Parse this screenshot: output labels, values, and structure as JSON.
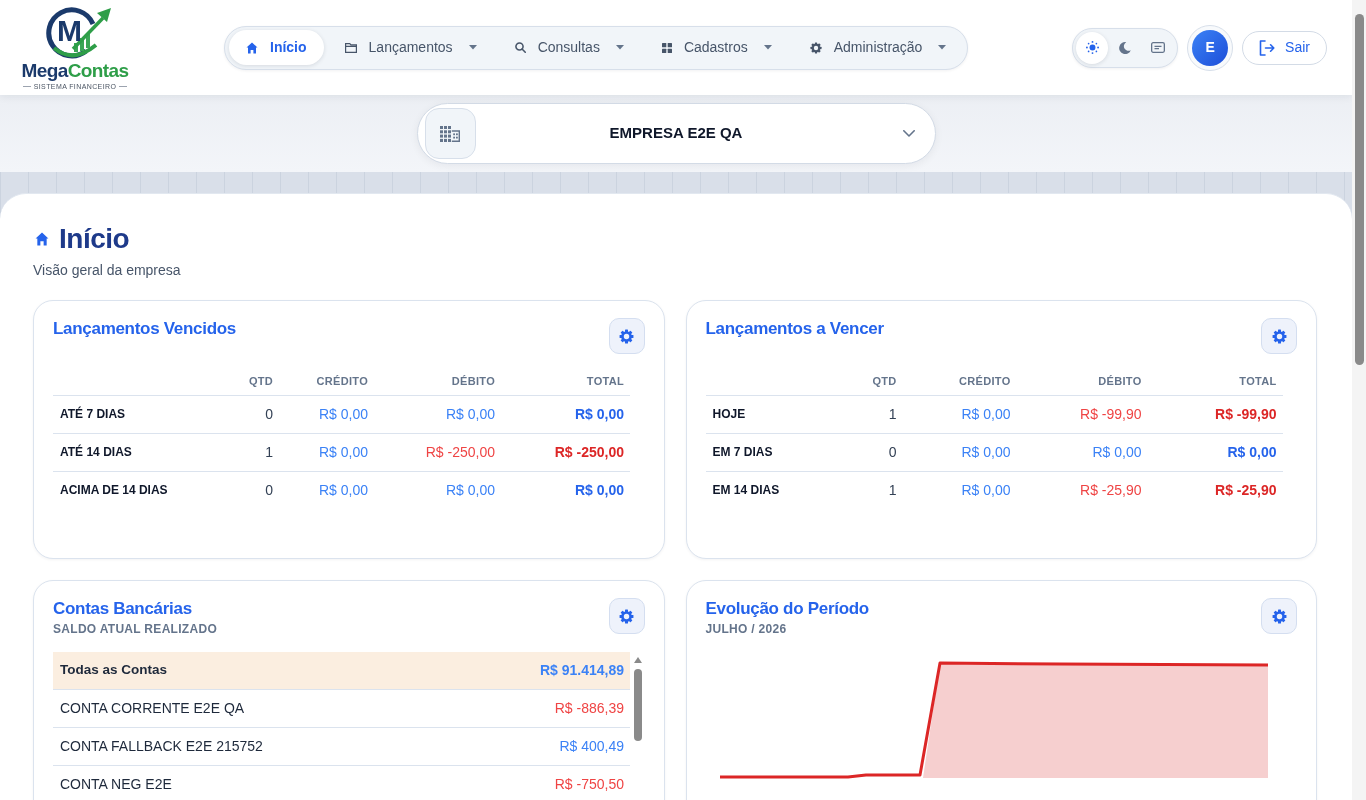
{
  "header": {
    "logo": {
      "monogram": "M",
      "brand_first": "Mega",
      "brand_second": "Contas",
      "tagline": "SISTEMA FINANCEIRO"
    },
    "nav": [
      {
        "label": "Início",
        "selected": true,
        "has_menu": false
      },
      {
        "label": "Lançamentos",
        "selected": false,
        "has_menu": true
      },
      {
        "label": "Consultas",
        "selected": false,
        "has_menu": true
      },
      {
        "label": "Cadastros",
        "selected": false,
        "has_menu": true
      },
      {
        "label": "Administração",
        "selected": false,
        "has_menu": true
      }
    ],
    "theme_options": [
      {
        "selected": true
      },
      {
        "selected": false
      },
      {
        "selected": false
      }
    ],
    "user": {
      "initial": "E"
    },
    "logout": {
      "label": "Sair"
    }
  },
  "company_selector": {
    "name": "EMPRESA E2E QA"
  },
  "page": {
    "title": "Início",
    "subtitle": "Visão geral da empresa"
  },
  "overdue": {
    "title": "Lançamentos Vencidos",
    "columns": [
      "QTD",
      "CRÉDITO",
      "DÉBITO",
      "TOTAL"
    ],
    "rows": [
      {
        "label": "ATÉ 7 DIAS",
        "qty": "0",
        "credit": {
          "text": "R$ 0,00",
          "negative": false
        },
        "debit": {
          "text": "R$ 0,00",
          "negative": false
        },
        "total": {
          "text": "R$ 0,00",
          "negative": false
        }
      },
      {
        "label": "ATÉ 14 DIAS",
        "qty": "1",
        "credit": {
          "text": "R$ 0,00",
          "negative": false
        },
        "debit": {
          "text": "R$ -250,00",
          "negative": true
        },
        "total": {
          "text": "R$ -250,00",
          "negative": true
        }
      },
      {
        "label": "ACIMA DE 14 DIAS",
        "qty": "0",
        "credit": {
          "text": "R$ 0,00",
          "negative": false
        },
        "debit": {
          "text": "R$ 0,00",
          "negative": false
        },
        "total": {
          "text": "R$ 0,00",
          "negative": false
        }
      }
    ]
  },
  "upcoming": {
    "title": "Lançamentos a Vencer",
    "columns": [
      "QTD",
      "CRÉDITO",
      "DÉBITO",
      "TOTAL"
    ],
    "rows": [
      {
        "label": "HOJE",
        "qty": "1",
        "credit": {
          "text": "R$ 0,00",
          "negative": false
        },
        "debit": {
          "text": "R$ -99,90",
          "negative": true
        },
        "total": {
          "text": "R$ -99,90",
          "negative": true
        }
      },
      {
        "label": "EM 7 DIAS",
        "qty": "0",
        "credit": {
          "text": "R$ 0,00",
          "negative": false
        },
        "debit": {
          "text": "R$ 0,00",
          "negative": false
        },
        "total": {
          "text": "R$ 0,00",
          "negative": false
        }
      },
      {
        "label": "EM 14 DIAS",
        "qty": "1",
        "credit": {
          "text": "R$ 0,00",
          "negative": false
        },
        "debit": {
          "text": "R$ -25,90",
          "negative": true
        },
        "total": {
          "text": "R$ -25,90",
          "negative": true
        }
      }
    ]
  },
  "bank_accounts": {
    "title": "Contas Bancárias",
    "subtitle": "SALDO ATUAL REALIZADO",
    "accounts": [
      {
        "name": "Todas as Contas",
        "balance": "R$ 91.414,89",
        "negative": false,
        "selected": true
      },
      {
        "name": "CONTA CORRENTE E2E QA",
        "balance": "R$ -886,39",
        "negative": true,
        "selected": false
      },
      {
        "name": "CONTA FALLBACK E2E 215752",
        "balance": "R$ 400,49",
        "negative": false,
        "selected": false
      },
      {
        "name": "CONTA NEG E2E",
        "balance": "R$ -750,50",
        "negative": true,
        "selected": false
      }
    ]
  },
  "evolution": {
    "title": "Evolução do Período",
    "subtitle": "JULHO / 2026"
  }
}
